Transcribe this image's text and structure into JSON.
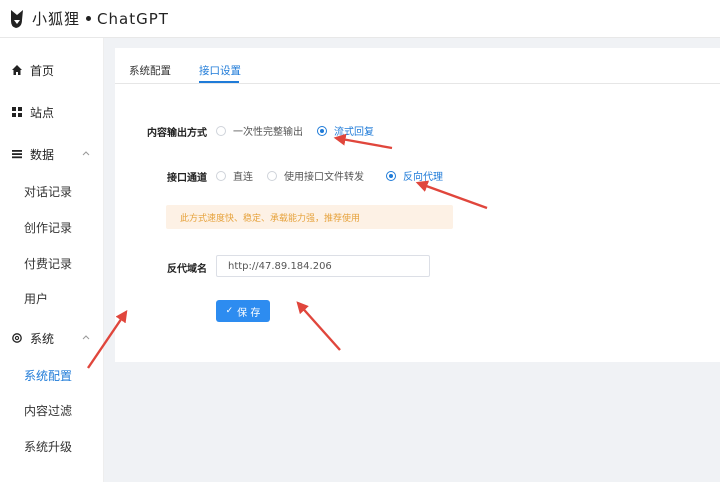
{
  "header": {
    "logo_text": "小狐狸",
    "product": "ChatGPT"
  },
  "sidebar": {
    "items": [
      {
        "label": "首页",
        "icon": "home-icon"
      },
      {
        "label": "站点",
        "icon": "grid-icon"
      },
      {
        "label": "数据",
        "icon": "list-icon"
      },
      {
        "label": "系统",
        "icon": "gear-icon"
      }
    ],
    "data_children": [
      "对话记录",
      "创作记录",
      "付费记录",
      "用户"
    ],
    "system_children": [
      "系统配置",
      "内容过滤",
      "系统升级"
    ],
    "active": "系统配置"
  },
  "tabs": [
    {
      "label": "系统配置",
      "active": false
    },
    {
      "label": "接口设置",
      "active": true
    }
  ],
  "form": {
    "output_mode": {
      "label": "内容输出方式",
      "options": [
        "一次性完整输出",
        "流式回复"
      ],
      "selected": "流式回复"
    },
    "channel": {
      "label": "接口通道",
      "options": [
        "直连",
        "使用接口文件转发",
        "反向代理"
      ],
      "selected": "反向代理"
    },
    "alert": "此方式速度快、稳定、承载能力强，推荐使用",
    "proxy_domain": {
      "label": "反代域名",
      "value": "http://47.89.184.206"
    },
    "save_label": "保 存"
  },
  "colors": {
    "accent": "#1f7bd8",
    "button": "#2d8cf0",
    "alert_bg": "#fdf1e5",
    "alert_text": "#e6a23c",
    "annotation_arrow": "#e0463c"
  }
}
